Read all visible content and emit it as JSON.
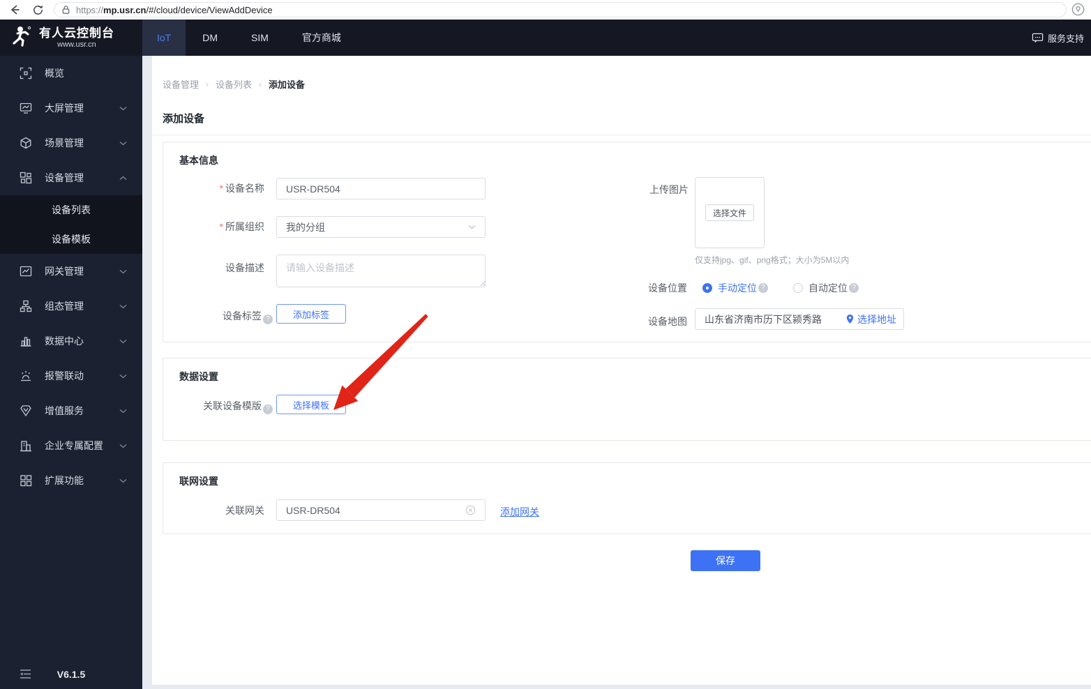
{
  "browser": {
    "url_scheme": "https://",
    "url_host": "mp.usr.cn",
    "url_path": "/#/cloud/device/ViewAddDevice"
  },
  "header": {
    "logo_title": "有人云控制台",
    "logo_subtitle": "www.usr.cn",
    "tabs": [
      {
        "label": "IoT"
      },
      {
        "label": "DM"
      },
      {
        "label": "SIM"
      },
      {
        "label": "官方商城"
      }
    ],
    "support_label": "服务支持"
  },
  "sidebar": {
    "items": [
      {
        "label": "概览"
      },
      {
        "label": "大屏管理"
      },
      {
        "label": "场景管理"
      },
      {
        "label": "设备管理"
      },
      {
        "label": "网关管理"
      },
      {
        "label": "组态管理"
      },
      {
        "label": "数据中心"
      },
      {
        "label": "报警联动"
      },
      {
        "label": "增值服务"
      },
      {
        "label": "企业专属配置"
      },
      {
        "label": "扩展功能"
      }
    ],
    "subitems": [
      {
        "label": "设备列表"
      },
      {
        "label": "设备模板"
      }
    ],
    "version": "V6.1.5"
  },
  "breadcrumb": [
    "设备管理",
    "设备列表",
    "添加设备"
  ],
  "page": {
    "title": "添加设备"
  },
  "basic": {
    "section_title": "基本信息",
    "device_name_label": "设备名称",
    "device_name_value": "USR-DR504",
    "org_label": "所属组织",
    "org_value": "我的分组",
    "desc_label": "设备描述",
    "desc_placeholder": "请输入设备描述",
    "tag_label": "设备标签",
    "add_tag_button": "添加标签",
    "upload_label": "上传图片",
    "choose_file_button": "选择文件",
    "upload_hint": "仅支持jpg、gif、png格式；大小为5M以内",
    "location_label": "设备位置",
    "manual_location_label": "手动定位",
    "auto_location_label": "自动定位",
    "map_label": "设备地图",
    "map_value": "山东省济南市历下区颍秀路",
    "choose_address_label": "选择地址"
  },
  "data_settings": {
    "section_title": "数据设置",
    "template_label": "关联设备模版",
    "choose_template_button": "选择模板"
  },
  "network": {
    "section_title": "联网设置",
    "gateway_label": "关联网关",
    "gateway_value": "USR-DR504",
    "add_gateway_link": "添加网关"
  },
  "footer": {
    "save_button": "保存"
  },
  "colors": {
    "accent": "#3e72f4",
    "arrow": "#e02418",
    "nav_bg": "#151823",
    "sidebar_bg": "#1b2130"
  }
}
